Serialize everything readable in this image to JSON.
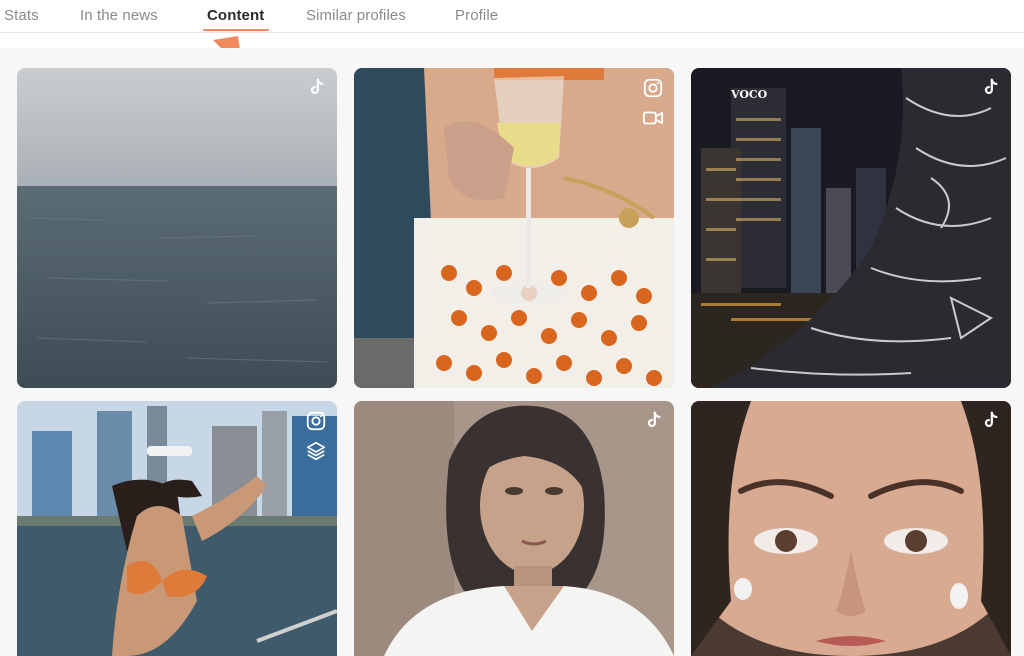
{
  "tabs": [
    {
      "label": "Stats",
      "active": false
    },
    {
      "label": "In the news",
      "active": false
    },
    {
      "label": "Content",
      "active": true
    },
    {
      "label": "Similar profiles",
      "active": false
    },
    {
      "label": "Profile",
      "active": false
    }
  ],
  "accent_color": "#f08a5d",
  "content": {
    "posts": [
      {
        "platform": "tiktok",
        "icons": [
          "tiktok-icon"
        ],
        "subject": "sea"
      },
      {
        "platform": "instagram",
        "icons": [
          "instagram-icon",
          "video-icon"
        ],
        "subject": "wine-glass"
      },
      {
        "platform": "tiktok",
        "icons": [
          "tiktok-icon"
        ],
        "subject": "city-night",
        "sign": "VOCO"
      },
      {
        "platform": "instagram",
        "icons": [
          "instagram-icon",
          "carousel-icon"
        ],
        "subject": "boat-skyline"
      },
      {
        "platform": "tiktok",
        "icons": [
          "tiktok-icon"
        ],
        "subject": "portrait"
      },
      {
        "platform": "tiktok",
        "icons": [
          "tiktok-icon"
        ],
        "subject": "closeup"
      }
    ]
  }
}
